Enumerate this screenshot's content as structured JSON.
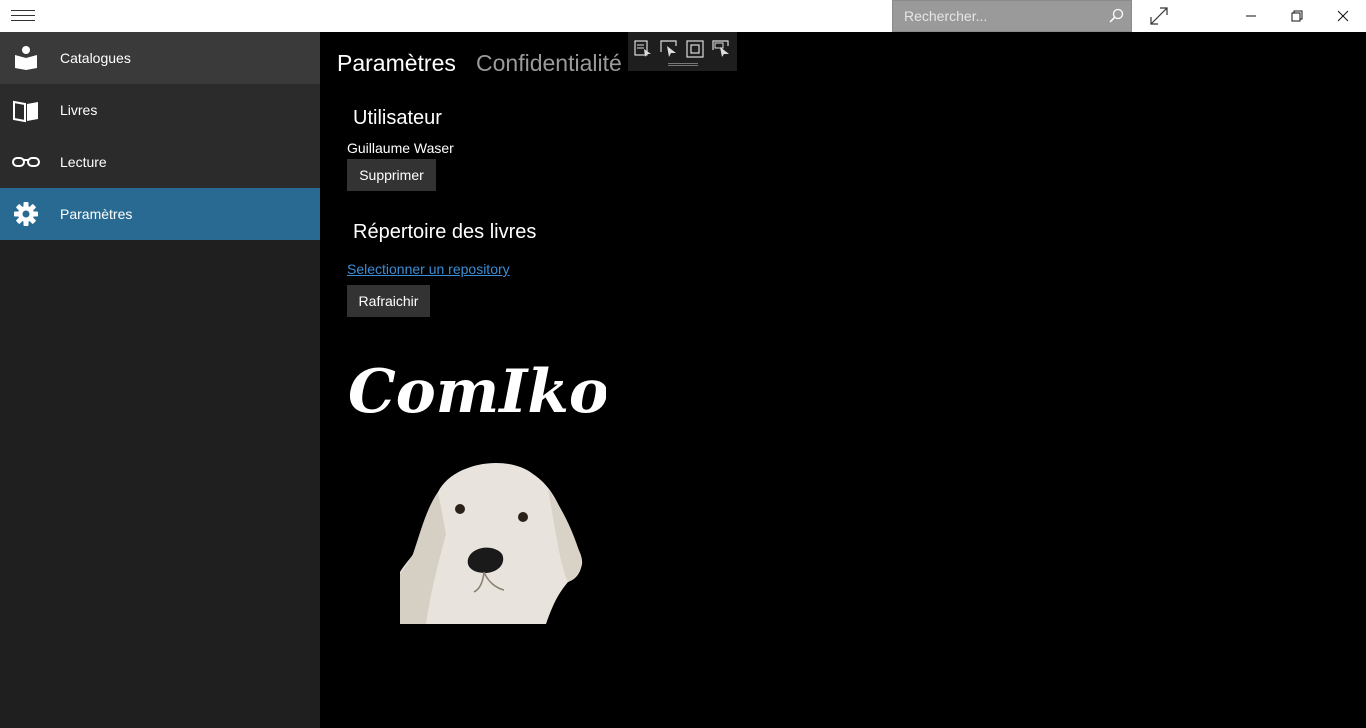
{
  "titlebar": {
    "search": {
      "placeholder": "Rechercher...",
      "value": ""
    },
    "icons": [
      "hamburger-icon",
      "search-icon",
      "expand-icon",
      "minimize-icon",
      "restore-icon",
      "close-icon"
    ]
  },
  "sidebar": {
    "items": [
      {
        "label": "Catalogues",
        "icon": "catalog-icon"
      },
      {
        "label": "Livres",
        "icon": "book-icon"
      },
      {
        "label": "Lecture",
        "icon": "glasses-icon"
      },
      {
        "label": "Paramètres",
        "icon": "gear-icon",
        "active": true
      }
    ]
  },
  "main": {
    "tabs": [
      {
        "label": "Paramètres",
        "active": true
      },
      {
        "label": "Confidentialité",
        "active": false
      }
    ],
    "user_section": {
      "title": "Utilisateur",
      "name": "Guillaume Waser",
      "delete_label": "Supprimer"
    },
    "repo_section": {
      "title": "Répertoire des livres",
      "select_link": "Selectionner un repository",
      "refresh_label": "Rafraichir"
    },
    "logo_text": "ComIko"
  },
  "colors": {
    "accent": "#286a92",
    "link": "#3b8ed6",
    "sidebar_bg": "#1f1f1f",
    "main_bg": "#000000",
    "search_bg": "#9a9a9a"
  }
}
